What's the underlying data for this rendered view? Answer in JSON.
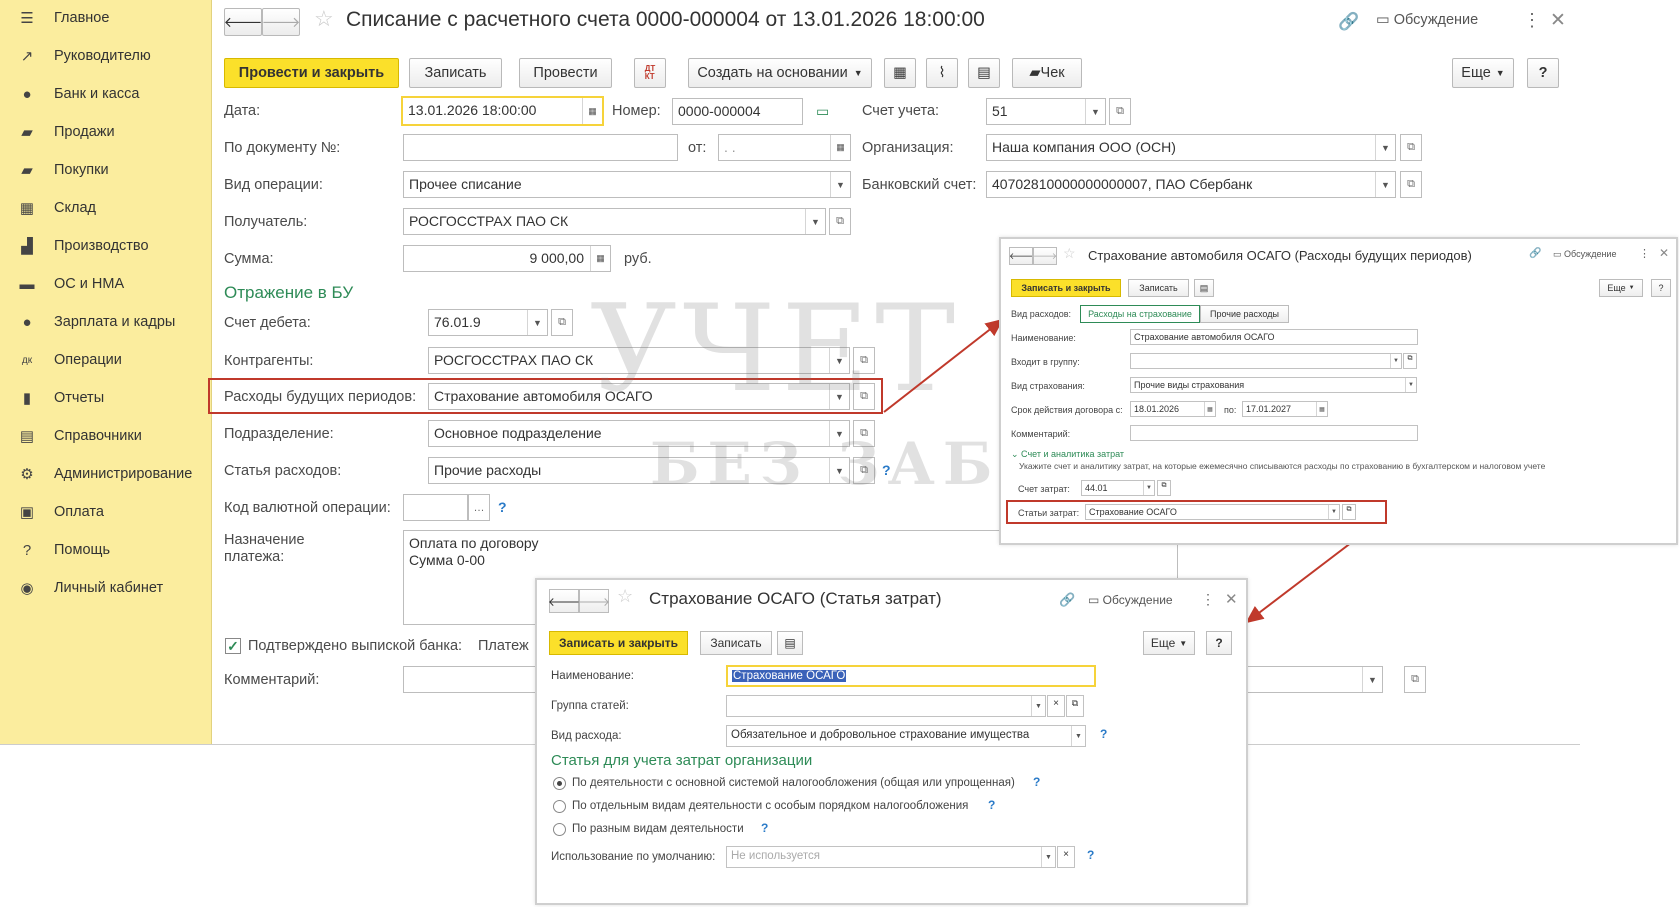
{
  "sidebar": {
    "items": [
      {
        "label": "Главное",
        "icon": "menu-icon",
        "glyph": "☰"
      },
      {
        "label": "Руководителю",
        "icon": "trend-icon",
        "glyph": "↗"
      },
      {
        "label": "Банк и касса",
        "icon": "coin-icon",
        "glyph": "●"
      },
      {
        "label": "Продажи",
        "icon": "bag-icon",
        "glyph": "▰"
      },
      {
        "label": "Покупки",
        "icon": "cart-icon",
        "glyph": "▰"
      },
      {
        "label": "Склад",
        "icon": "warehouse-icon",
        "glyph": "▦"
      },
      {
        "label": "Производство",
        "icon": "factory-icon",
        "glyph": "▟"
      },
      {
        "label": "ОС и НМА",
        "icon": "truck-icon",
        "glyph": "▬"
      },
      {
        "label": "Зарплата и кадры",
        "icon": "person-icon",
        "glyph": "●"
      },
      {
        "label": "Операции",
        "icon": "dt-kt-icon",
        "glyph": "дк"
      },
      {
        "label": "Отчеты",
        "icon": "bar-chart-icon",
        "glyph": "▮"
      },
      {
        "label": "Справочники",
        "icon": "book-icon",
        "glyph": "▤"
      },
      {
        "label": "Администрирование",
        "icon": "gear-icon",
        "glyph": "⚙"
      },
      {
        "label": "Оплата",
        "icon": "payment-icon",
        "glyph": "▣"
      },
      {
        "label": "Помощь",
        "icon": "question-icon",
        "glyph": "?"
      },
      {
        "label": "Личный кабинет",
        "icon": "user-circle-icon",
        "glyph": "◉"
      }
    ]
  },
  "doc": {
    "title": "Списание с расчетного счета 0000-000004 от 13.01.2026 18:00:00",
    "discussion": "Обсуждение",
    "toolbar": {
      "post_close": "Провести и закрыть",
      "save": "Записать",
      "post": "Провести",
      "dtkt": "ДТ КТ",
      "create_based": "Создать на основании",
      "check": "Чек",
      "more": "Еще",
      "help": "?"
    },
    "fields": {
      "date_label": "Дата:",
      "date_value": "13.01.2026 18:00:00",
      "number_label": "Номер:",
      "number_value": "0000-000004",
      "account_label": "Счет учета:",
      "account_value": "51",
      "docno_label": "По документу №:",
      "docno_value": "",
      "from_label": "от:",
      "from_value": " .  .",
      "org_label": "Организация:",
      "org_value": "Наша компания ООО (ОСН)",
      "optype_label": "Вид операции:",
      "optype_value": "Прочее списание",
      "bank_label": "Банковский счет:",
      "bank_value": "40702810000000000007, ПАО Сбербанк",
      "recipient_label": "Получатель:",
      "recipient_value": "РОСГОССТРАХ ПАО СК",
      "sum_label": "Сумма:",
      "sum_value": "9 000,00",
      "currency": "руб.",
      "section_bu": "Отражение в БУ",
      "debit_label": "Счет дебета:",
      "debit_value": "76.01.9",
      "contractors_label": "Контрагенты:",
      "contractors_value": "РОСГОССТРАХ ПАО СК",
      "rbp_label": "Расходы будущих периодов:",
      "rbp_value": "Страхование автомобиля ОСАГО",
      "division_label": "Подразделение:",
      "division_value": "Основное подразделение",
      "expense_label": "Статья расходов:",
      "expense_value": "Прочие расходы",
      "currency_op_label": "Код валютной операции:",
      "currency_op_value": "",
      "purpose_label": "Назначение платежа:",
      "purpose_line1": "Оплата по договору",
      "purpose_line2": "Сумма 0-00",
      "confirmed_label": "Подтверждено выпиской банка:",
      "payment_partial": "Платеж",
      "comment_label": "Комментарий:",
      "comment_value": ""
    }
  },
  "rbp_window": {
    "title": "Страхование автомобиля ОСАГО (Расходы будущих периодов)",
    "discussion": "Обсуждение",
    "save_close": "Записать и закрыть",
    "save": "Записать",
    "more": "Еще",
    "help": "?",
    "expense_kind_label": "Вид расходов:",
    "tab_insurance": "Расходы на страхование",
    "tab_other": "Прочие расходы",
    "name_label": "Наименование:",
    "name_value": "Страхование автомобиля ОСАГО",
    "group_label": "Входит в группу:",
    "group_value": "",
    "ins_kind_label": "Вид страхования:",
    "ins_kind_value": "Прочие виды страхования",
    "term_label": "Срок действия договора с:",
    "term_from": "18.01.2026",
    "term_to_label": "по:",
    "term_to": "17.01.2027",
    "comment_label": "Комментарий:",
    "comment_value": "",
    "analytics_header": "Счет и аналитика затрат",
    "analytics_hint": "Укажите счет и аналитику затрат, на которые ежемесячно списываются расходы по страхованию в бухгалтерском и налоговом учете",
    "cost_account_label": "Счет затрат:",
    "cost_account_value": "44.01",
    "cost_items_label": "Статьи затрат:",
    "cost_items_value": "Страхование ОСАГО"
  },
  "item_window": {
    "title": "Страхование ОСАГО (Статья затрат)",
    "discussion": "Обсуждение",
    "save_close": "Записать и закрыть",
    "save": "Записать",
    "more": "Еще",
    "help": "?",
    "name_label": "Наименование:",
    "name_value": "Страхование ОСАГО",
    "group_label": "Группа статей:",
    "group_value": "",
    "kind_label": "Вид расхода:",
    "kind_value": "Обязательное и добровольное страхование имущества",
    "section": "Статья для учета затрат организации",
    "radio1": "По деятельности с основной системой налогообложения (общая или упрощенная)",
    "radio2": "По отдельным видам деятельности с особым порядком налогообложения",
    "radio3": "По разным видам деятельности",
    "default_label": "Использование по умолчанию:",
    "default_placeholder": "Не используется"
  },
  "watermark": {
    "line1": "УЧЕТ",
    "line2": "БЕЗ ЗАБОТ"
  },
  "colors": {
    "accent_yellow": "#fbe02a",
    "sidebar": "#fbed9e",
    "section_green": "#2e8b57",
    "annotation_red": "#c0392b"
  }
}
